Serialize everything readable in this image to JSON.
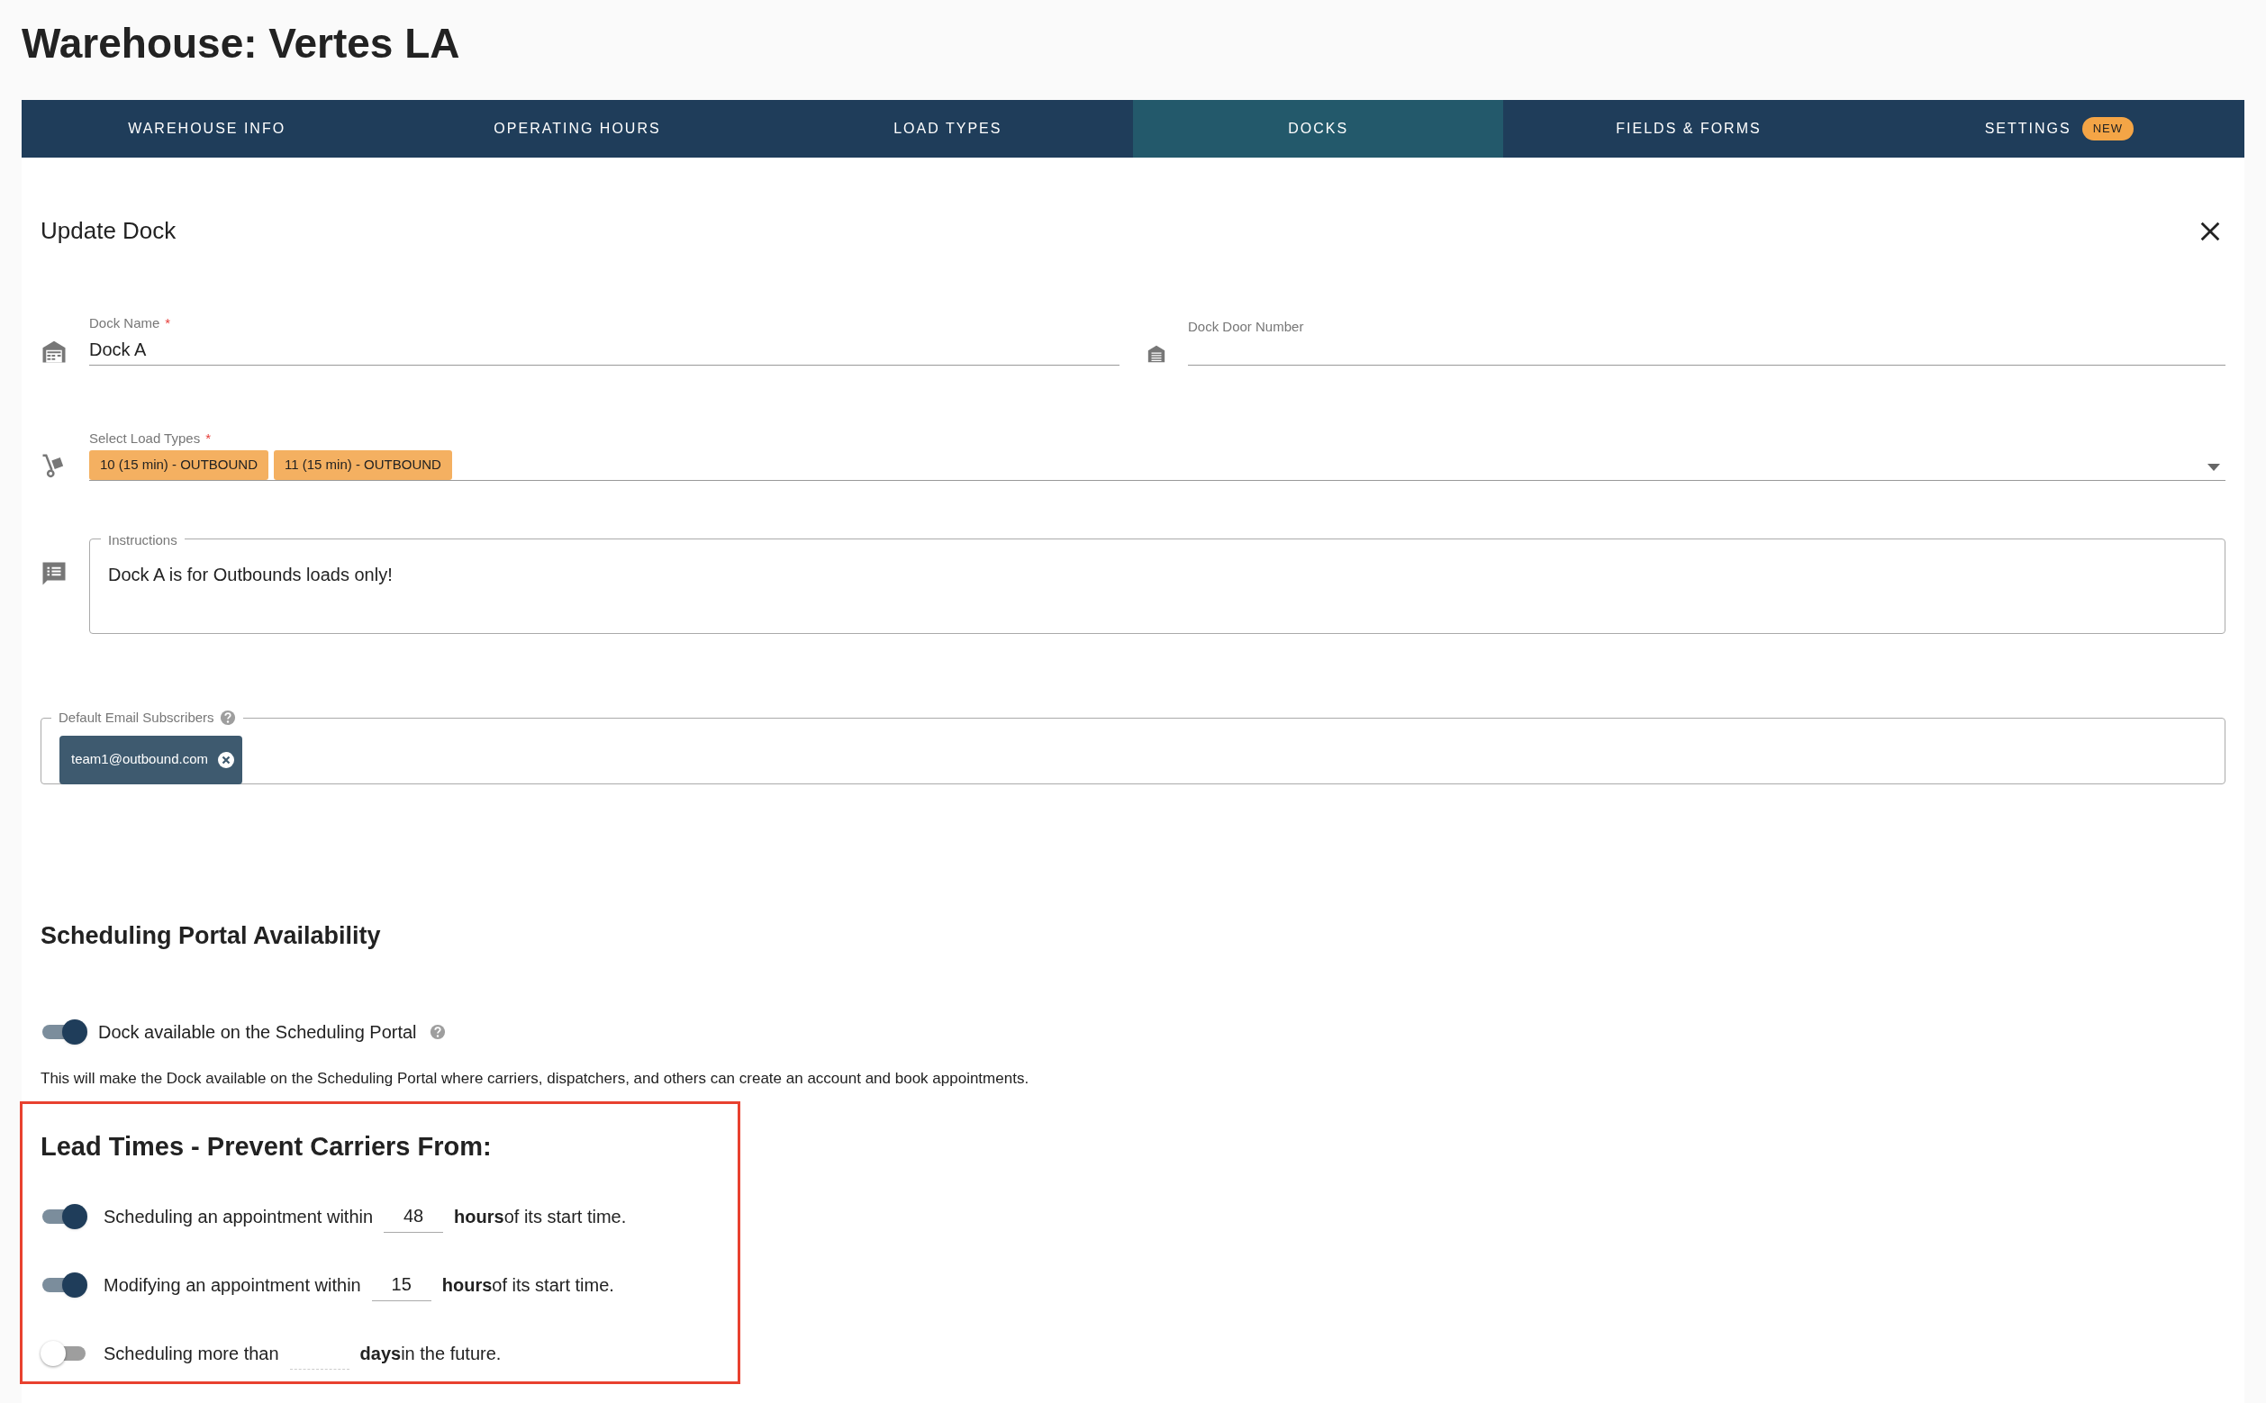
{
  "page_title": "Warehouse: Vertes LA",
  "tabs": [
    {
      "label": "WAREHOUSE INFO",
      "selected": false
    },
    {
      "label": "OPERATING HOURS",
      "selected": false
    },
    {
      "label": "LOAD TYPES",
      "selected": false
    },
    {
      "label": "DOCKS",
      "selected": true
    },
    {
      "label": "FIELDS & FORMS",
      "selected": false
    },
    {
      "label": "SETTINGS",
      "selected": false,
      "badge": "NEW"
    }
  ],
  "form": {
    "title": "Update Dock",
    "dock_name": {
      "label": "Dock Name",
      "required_mark": "*",
      "value": "Dock A"
    },
    "dock_door_number": {
      "label": "Dock Door Number"
    },
    "load_types": {
      "label": "Select Load Types",
      "required_mark": "*",
      "chips": [
        "10 (15 min) - OUTBOUND",
        "11 (15 min) - OUTBOUND"
      ]
    },
    "instructions": {
      "label": "Instructions",
      "value": "Dock A is for Outbounds loads only!"
    },
    "email_subscribers": {
      "label": "Default Email Subscribers",
      "chips": [
        "team1@outbound.com"
      ]
    }
  },
  "portal": {
    "title": "Scheduling Portal Availability",
    "toggle": {
      "label": "Dock available on the Scheduling Portal",
      "on": true
    },
    "description": "This will make the Dock available on the Scheduling Portal where carriers, dispatchers, and others can create an account and book appointments."
  },
  "lead_times": {
    "title": "Lead Times - Prevent Carriers From:",
    "rows": [
      {
        "label": "Scheduling an appointment within",
        "on": true,
        "value": "48",
        "unit": "hours",
        "suffix": "of its start time."
      },
      {
        "label": "Modifying an appointment within",
        "on": true,
        "value": "15",
        "unit": "hours",
        "suffix": "of its start time."
      },
      {
        "label": "Scheduling more than",
        "on": false,
        "value": "",
        "unit": "days",
        "suffix": "in the future."
      }
    ]
  }
}
